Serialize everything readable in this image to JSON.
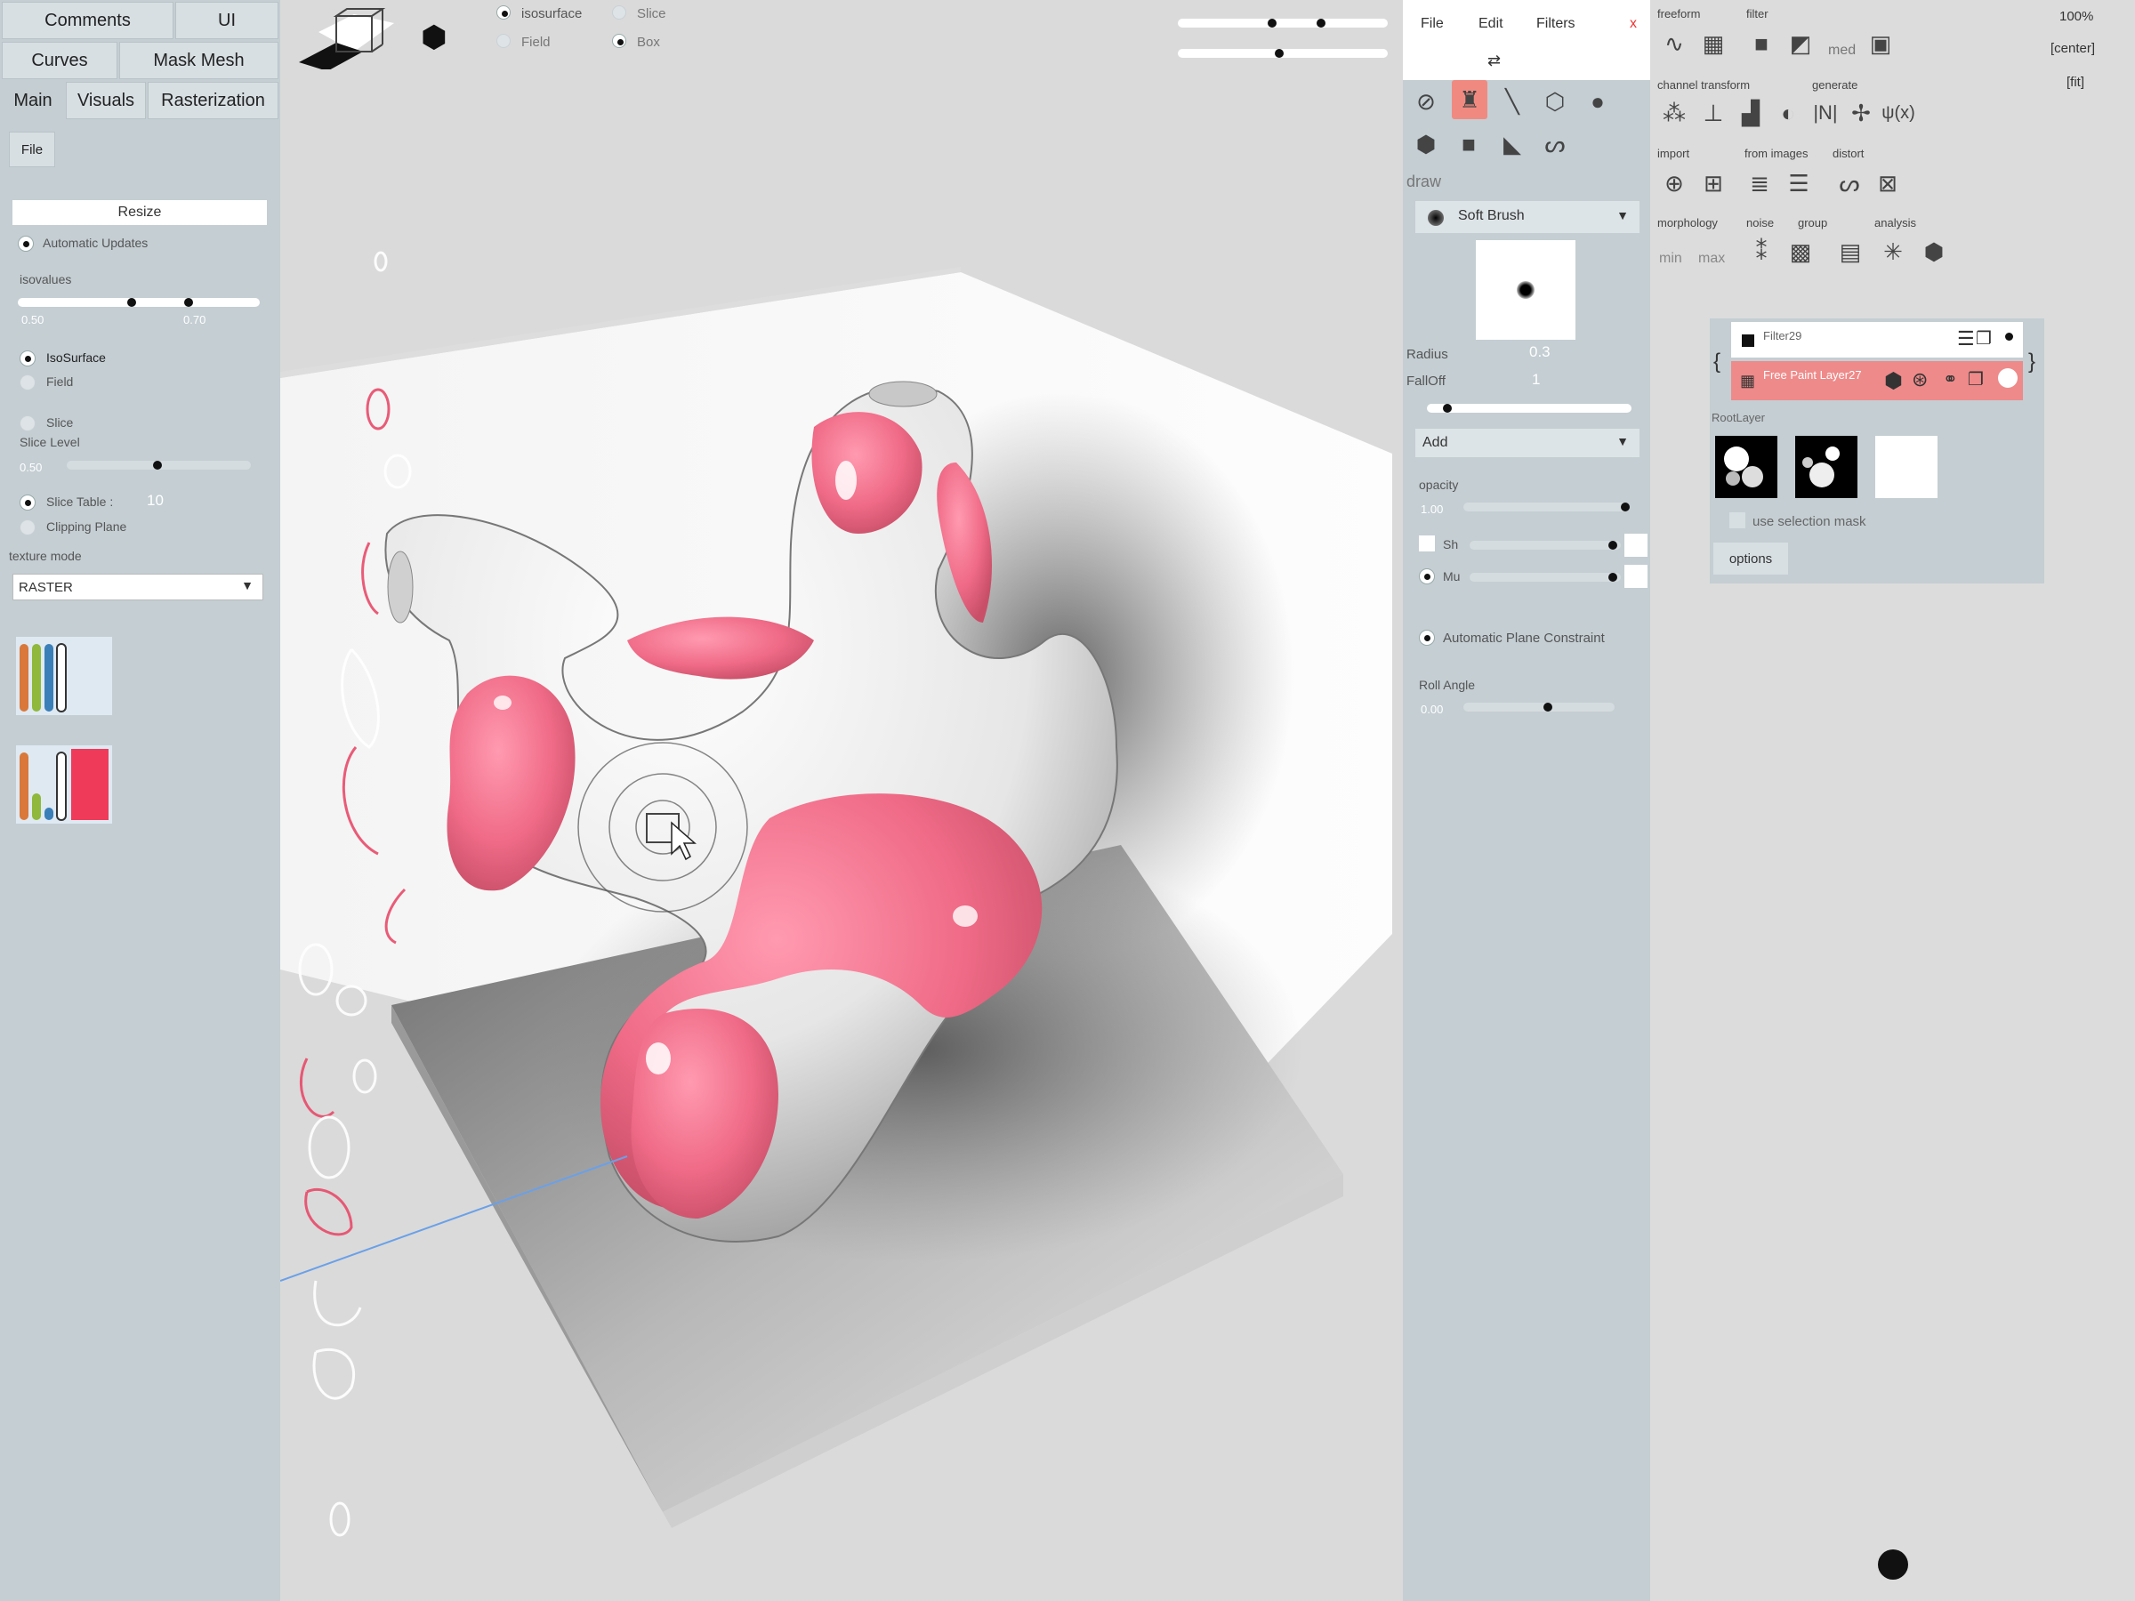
{
  "left_panel": {
    "tabs_row1": [
      "Comments",
      "UI"
    ],
    "tabs_row2": [
      "Curves",
      "Mask Mesh"
    ],
    "tabs_row3": [
      "Main",
      "Visuals",
      "Rasterization"
    ],
    "file_button": "File",
    "resize_button": "Resize",
    "automatic_updates": "Automatic Updates",
    "isovalues_label": "isovalues",
    "isovalue_low": "0.50",
    "isovalue_high": "0.70",
    "isosurface": "IsoSurface",
    "field": "Field",
    "slice": "Slice",
    "slice_level_label": "Slice Level",
    "slice_level_value": "0.50",
    "slice_table_label": "Slice Table :",
    "slice_table_value": "10",
    "clipping_plane": "Clipping Plane",
    "texture_mode_label": "texture mode",
    "texture_mode_value": "RASTER"
  },
  "viewport_top": {
    "radio_isosurface": "isosurface",
    "radio_slice": "Slice",
    "radio_field": "Field",
    "radio_box": "Box",
    "level_isosurface": 0.8,
    "level_field": 0.5
  },
  "mid_panel": {
    "menu": [
      "File",
      "Edit",
      "Filters"
    ],
    "close": "x",
    "draw_label": "draw",
    "brush_name": "Soft Brush",
    "radius_label": "Radius",
    "radius_value": "0.3",
    "falloff_label": "FallOff",
    "falloff_value": "1",
    "blend_mode": "Add",
    "opacity_label": "opacity",
    "opacity_value": "1.00",
    "sh_label": "Sh",
    "mu_label": "Mu",
    "auto_plane": "Automatic Plane Constraint",
    "roll_angle_label": "Roll Angle",
    "roll_angle_value": "0.00"
  },
  "filter_toolbar": {
    "freeform": "freeform",
    "filter": "filter",
    "med": "med",
    "channel_transform": "channel transform",
    "generate": "generate",
    "import": "import",
    "from_images": "from images",
    "distort": "distort",
    "morphology": "morphology",
    "min": "min",
    "max": "max",
    "noise": "noise",
    "group": "group",
    "analysis": "analysis"
  },
  "layers": {
    "filter_layer": "Filter29",
    "paint_layer": "Free Paint Layer27",
    "root_layer": "RootLayer",
    "use_selection_mask": "use selection mask",
    "options_button": "options"
  },
  "zoom": {
    "percent": "100%",
    "center": "[center]",
    "fit": "[fit]"
  },
  "colors": {
    "accent_pink": "#f06b87",
    "active_layer": "#ee8a8a",
    "panel_bg": "#c4ced3"
  }
}
